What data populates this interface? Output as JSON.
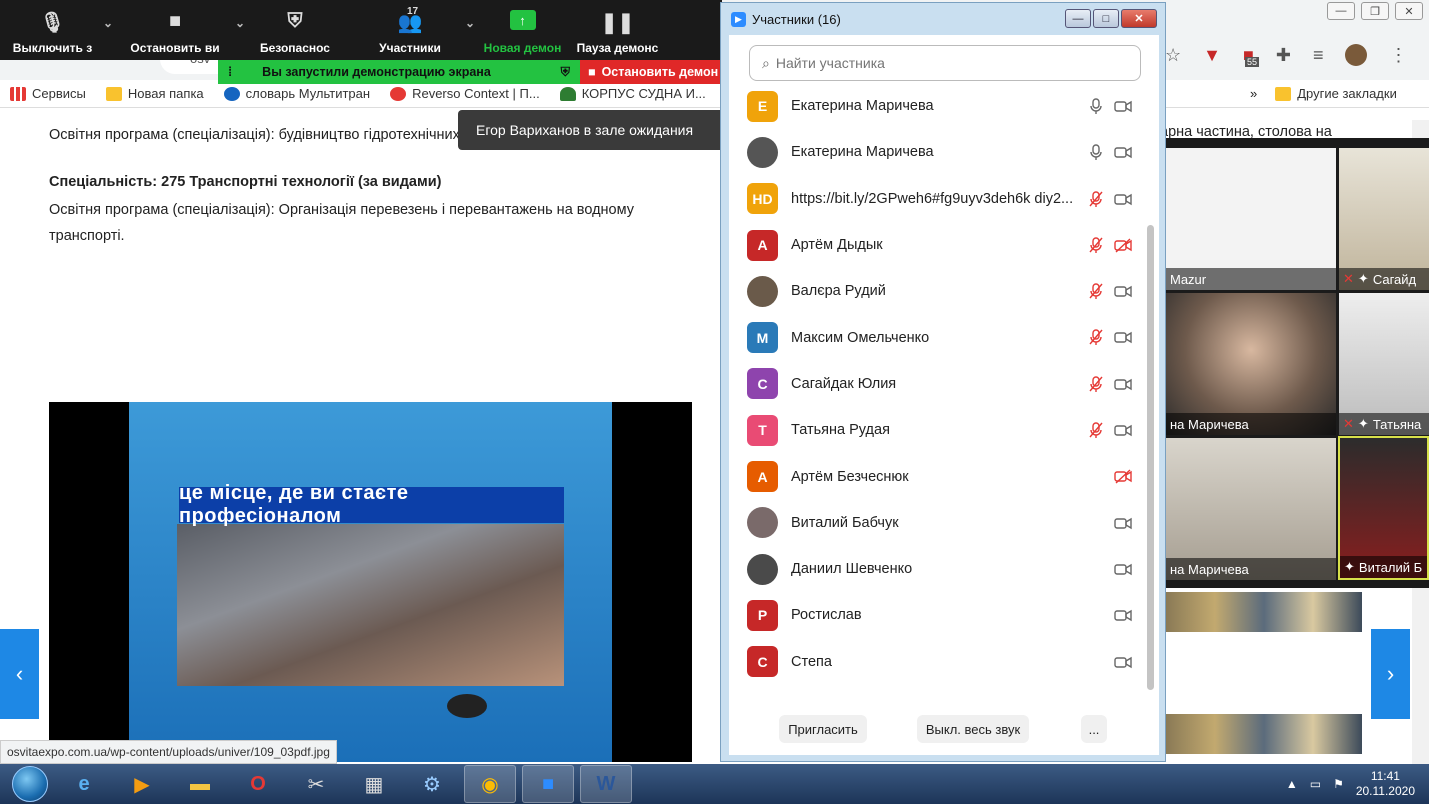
{
  "browser": {
    "address_fragment": "osv",
    "bookmarks": [
      {
        "label": "Сервисы",
        "color": "#e53935"
      },
      {
        "label": "Новая папка",
        "color": "#f9c22e"
      },
      {
        "label": "словарь Мультитран",
        "color": "#1565c0"
      },
      {
        "label": "Reverso Context | П...",
        "color": "#e53935"
      },
      {
        "label": "КОРПУС СУДНА И...",
        "color": "#2e7d32"
      }
    ],
    "more_label": "»",
    "other_bookmarks": "Другие закладки",
    "extension_badge": "55"
  },
  "page": {
    "line1": "Освітня програма (спеціалізація): будівництво гідротехнічних споруд",
    "specialty": "Спеціальність: 275 Транспортні технології (за видами)",
    "program": "Освітня програма (спеціалізація): Організація перевезень і перевантажень на водному транспорті.",
    "video_caption": "це місце, де ви стаєте професіоналом",
    "status_url": "osvitaexpo.com.ua/wp-content/uploads/univer/109_03pdf.jpg",
    "prev_label": "‹",
    "next_label": "›",
    "right_text": "арна частина, столова на"
  },
  "zoom_toolbar": {
    "mute": "Выключить з",
    "video": "Остановить ви",
    "security": "Безопаснос",
    "participants": "Участники",
    "participants_count": "17",
    "new_share": "Новая демон",
    "pause_share": "Пауза демонс",
    "sharing_notice": "Вы запустили демонстрацию экрана",
    "stop_share": "Остановить демон",
    "waiting_notice": "Егор Вариханов в зале ожидания"
  },
  "participants_window": {
    "title": "Участники (16)",
    "search_placeholder": "Найти участника",
    "invite": "Пригласить",
    "mute_all": "Выкл. весь звук",
    "more": "...",
    "list": [
      {
        "name": "Екатерина Маричева",
        "initial": "Е",
        "color": "#f0a30a",
        "mic": "on",
        "cam": "on"
      },
      {
        "name": "Екатерина Маричева",
        "initial": "",
        "color": "#555555",
        "mic": "on",
        "cam": "on"
      },
      {
        "name": "https://bit.ly/2GPweh6#fg9uyv3deh6k diy2...",
        "initial": "HD",
        "color": "#f0a30a",
        "mic": "off",
        "cam": "on"
      },
      {
        "name": "Артём Дыдык",
        "initial": "А",
        "color": "#c62828",
        "mic": "off",
        "cam": "off"
      },
      {
        "name": "Валєра Рудий",
        "initial": "",
        "color": "#6a5a4a",
        "mic": "off",
        "cam": "on"
      },
      {
        "name": "Максим Омельченко",
        "initial": "М",
        "color": "#2a7ab8",
        "mic": "off",
        "cam": "on"
      },
      {
        "name": "Сагайдак Юлия",
        "initial": "С",
        "color": "#8e44ad",
        "mic": "off",
        "cam": "on"
      },
      {
        "name": "Татьяна Рудая",
        "initial": "Т",
        "color": "#e94b74",
        "mic": "off",
        "cam": "on"
      },
      {
        "name": "Артём Безчеснюк",
        "initial": "А",
        "color": "#e65c00",
        "mic": "none",
        "cam": "off"
      },
      {
        "name": "Виталий Бабчук",
        "initial": "",
        "color": "#7a6a6a",
        "mic": "none",
        "cam": "on"
      },
      {
        "name": "Даниил Шевченко",
        "initial": "",
        "color": "#4a4a4a",
        "mic": "none",
        "cam": "on"
      },
      {
        "name": "Ростислав",
        "initial": "Р",
        "color": "#c62828",
        "mic": "none",
        "cam": "on"
      },
      {
        "name": "Степа",
        "initial": "С",
        "color": "#c62828",
        "mic": "none",
        "cam": "on"
      }
    ]
  },
  "gallery": {
    "tiles": [
      {
        "label": "Mazur"
      },
      {
        "label": "Сагайд"
      },
      {
        "label": "на Маричева"
      },
      {
        "label": "Татьяна"
      },
      {
        "label": "на Маричева"
      },
      {
        "label": "Виталий Б"
      }
    ]
  },
  "taskbar": {
    "time": "11:41",
    "date": "20.11.2020"
  }
}
